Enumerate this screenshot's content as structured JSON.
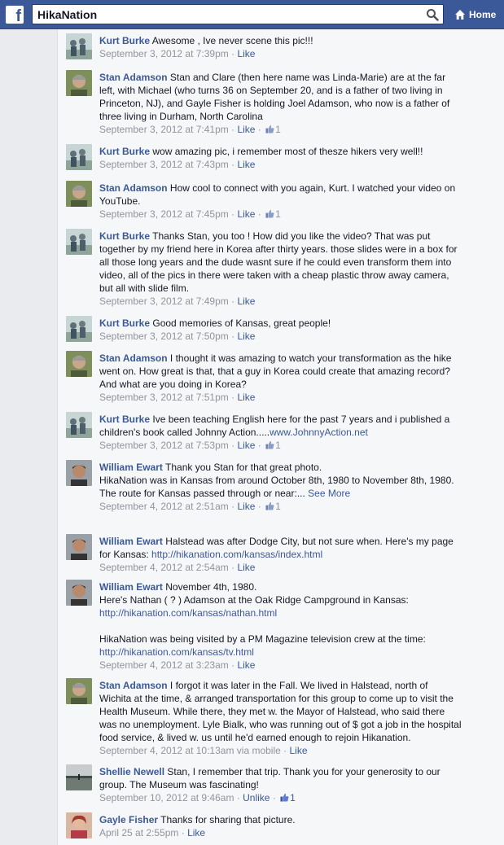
{
  "header": {
    "logo": "f",
    "search_value": "HikaNation",
    "home_label": "Home",
    "search_icon": "search-icon",
    "home_icon": "home-icon"
  },
  "colors": {
    "topbar": "#3b5998",
    "link": "#3b5998",
    "meta": "#90949c",
    "text": "#141823"
  },
  "comments": [
    {
      "author": "Kurt Burke",
      "text": "Awesome , Ive never scene this pic!!!",
      "time": "September 3, 2012 at 7:39pm",
      "action": "Like"
    },
    {
      "author": "Stan Adamson",
      "text": "Stan and Clare (then here name was Linda-Marie) are at the far left, with Michael (who turns 36 on September 20, and is a father of two living in Princeton, NJ), and Gayle Fisher is holding Joel Adamson, who now is a father of three living in Durham, North Carolina",
      "time": "September 3, 2012 at 7:41pm",
      "action": "Like",
      "likes": "1"
    },
    {
      "author": "Kurt Burke",
      "text": "wow amazing pic, i remember most of thesze hikers very well!!",
      "time": "September 3, 2012 at 7:43pm",
      "action": "Like"
    },
    {
      "author": "Stan Adamson",
      "text": "How cool to connect with you again, Kurt. I watched your video on YouTube.",
      "time": "September 3, 2012 at 7:45pm",
      "action": "Like",
      "likes": "1"
    },
    {
      "author": "Kurt Burke",
      "text": "Thanks Stan, you too ! How did you like the video? That was put together by my friend here in Korea after thirty years. those slides were in a box for all those long years and the dude wasnt sure if he could even transform them into video, all of the pics in there were taken with a cheap plastic throw away camera, but all with slide film.",
      "time": "September 3, 2012 at 7:49pm",
      "action": "Like"
    },
    {
      "author": "Kurt Burke",
      "text": "Good memories of Kansas, great people!",
      "time": "September 3, 2012 at 7:50pm",
      "action": "Like"
    },
    {
      "author": "Stan Adamson",
      "text": "I thought it was amazing to watch your transformation as the hike went on. How great is that, that a guy in Korea could create that amazing record? And what are you doing in Korea?",
      "time": "September 3, 2012 at 7:51pm",
      "action": "Like"
    },
    {
      "author": "Kurt Burke",
      "text": "Ive been teaching English here for the past 7 years and i published a children's book called Johnny Action.....",
      "link": "www.JohnnyAction.net",
      "time": "September 3, 2012 at 7:53pm",
      "action": "Like",
      "likes": "1"
    },
    {
      "author": "William Ewart",
      "text": "Thank you Stan for that great photo.\nHikaNation was in Kansas from around October 8th, 1980 to November 8th, 1980.\nThe route for Kansas passed through or near:... ",
      "link": "See More",
      "time": "September 4, 2012 at 2:51am",
      "action": "Like",
      "likes": "1"
    },
    {
      "author": "William Ewart",
      "text": "Halstead was after Dodge City, but not sure when. Here's my page for Kansas: ",
      "link": "http://hikanation.com/kansas/index.html",
      "time": "September 4, 2012 at 2:54am",
      "action": "Like"
    },
    {
      "author": "William Ewart",
      "text": "November 4th, 1980.\nHere's Nathan ( ? ) Adamson at the Oak Ridge Campground in Kansas:",
      "link": "http://hikanation.com/kansas/nathan.html",
      "text2": "HikaNation was being visited by a PM Magazine television crew at the time:",
      "link2": "http://hikanation.com/kansas/tv.html",
      "time": "September 4, 2012 at 3:23am",
      "action": "Like"
    },
    {
      "author": "Stan Adamson",
      "text": "I forgot it was later in the Fall. We lived in Halstead, north of Wichita at the time, & arranged transportation for this group to come up to visit the Health Museum. While there, they met w. the Mayor of Halstead, who said there was no unemployment. Lyle Bialk, who was running out of $ got a job in the hospital food service, & lived w. us until he'd earned enough to rejoin Hikanation.",
      "time": "September 4, 2012 at 10:13am via mobile",
      "action": "Like"
    },
    {
      "author": "Shellie Newell",
      "text": "Stan, I remember that trip. Thank you for your generosity to our group. The Museum was fascinating!",
      "time": "September 10, 2012 at 9:46am",
      "action": "Unlike",
      "likes": "1"
    },
    {
      "author": "Gayle Fisher",
      "text": "Thanks for sharing that picture.",
      "time": "April 25 at 2:55pm",
      "action": "Like"
    }
  ]
}
